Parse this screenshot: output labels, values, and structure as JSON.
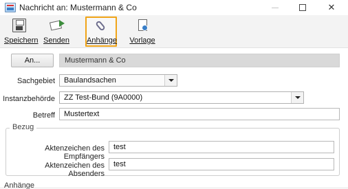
{
  "window": {
    "title": "Nachricht an: Mustermann & Co",
    "minimize_glyph": "",
    "maximize_glyph": "",
    "close_glyph": "✕"
  },
  "toolbar": {
    "save_label": "Speichern",
    "send_label": "Senden",
    "attachments_label": "Anhänge",
    "template_label": "Vorlage",
    "highlight_color": "#f0a417"
  },
  "recipient": {
    "button_label": "An...",
    "value": "Mustermann & Co"
  },
  "form": {
    "sachgebiet_label": "Sachgebiet",
    "sachgebiet_value": "Baulandsachen",
    "instanz_label": "Instanzbehörde",
    "instanz_value": "ZZ Test-Bund (9A0000)",
    "betreff_label": "Betreff",
    "betreff_value": "Mustertext"
  },
  "bezug": {
    "title": "Bezug",
    "empfaenger_label": "Aktenzeichen des Empfängers",
    "empfaenger_value": "test",
    "absender_label": "Aktenzeichen des Absenders",
    "absender_value": "test"
  },
  "attachments_section": {
    "header": "Anhänge"
  },
  "icons": [
    "app-icon",
    "floppy-disk-icon",
    "send-envelope-icon",
    "paperclip-icon",
    "template-document-icon",
    "chevron-down-icon"
  ]
}
